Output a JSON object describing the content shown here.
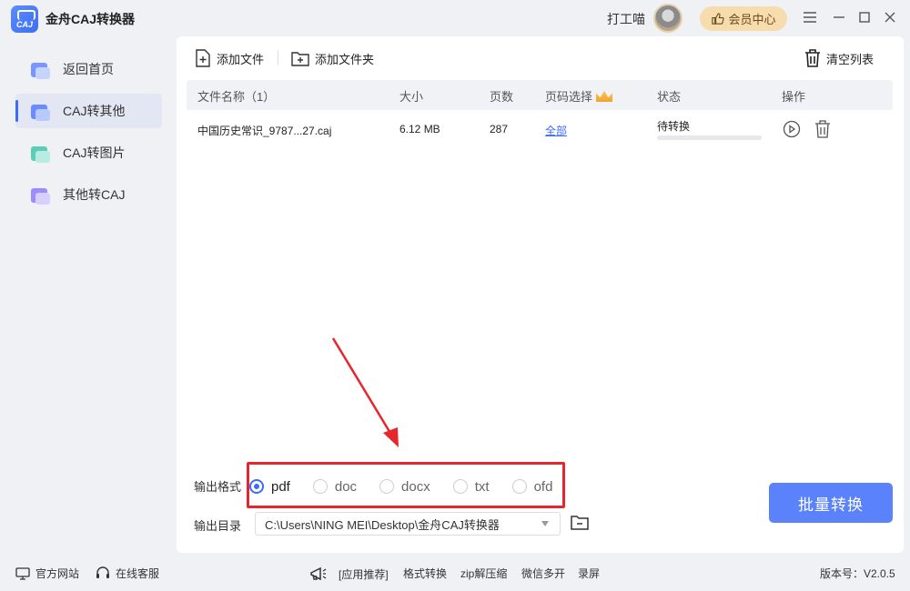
{
  "app": {
    "title": "金舟CAJ转换器",
    "logo_text": "CAJ",
    "user_name": "打工喵",
    "vip_label": "会员中心"
  },
  "sidebar": {
    "items": [
      {
        "label": "返回首页",
        "icon": "home-icon"
      },
      {
        "label": "CAJ转其他",
        "icon": "caj-convert-icon",
        "active": true
      },
      {
        "label": "CAJ转图片",
        "icon": "caj-image-icon"
      },
      {
        "label": "其他转CAJ",
        "icon": "other-to-caj-icon"
      }
    ]
  },
  "toolbar": {
    "add_file": "添加文件",
    "add_folder": "添加文件夹",
    "clear_list": "清空列表"
  },
  "table": {
    "headers": {
      "name": "文件名称（1）",
      "size": "大小",
      "pages": "页数",
      "page_select": "页码选择",
      "status": "状态",
      "actions": "操作"
    },
    "rows": [
      {
        "name": "中国历史常识_9787...27.caj",
        "size": "6.12 MB",
        "pages": "287",
        "page_select": "全部",
        "status": "待转换",
        "progress": 0
      }
    ]
  },
  "output": {
    "format_label": "输出格式",
    "formats": [
      "pdf",
      "doc",
      "docx",
      "txt",
      "ofd"
    ],
    "selected_format": "pdf",
    "dir_label": "输出目录",
    "dir_value": "C:\\Users\\NING MEI\\Desktop\\金舟CAJ转换器",
    "batch_button": "批量转换"
  },
  "footer": {
    "website": "官方网站",
    "support": "在线客服",
    "recommend": "[应用推荐]",
    "links": [
      "格式转换",
      "zip解压缩",
      "微信多开",
      "录屏"
    ],
    "version": "版本号：V2.0.5"
  },
  "colors": {
    "accent": "#3e6bf7",
    "button": "#5a82fa",
    "highlight": "#e5262d",
    "vip": "#f7dcae"
  }
}
